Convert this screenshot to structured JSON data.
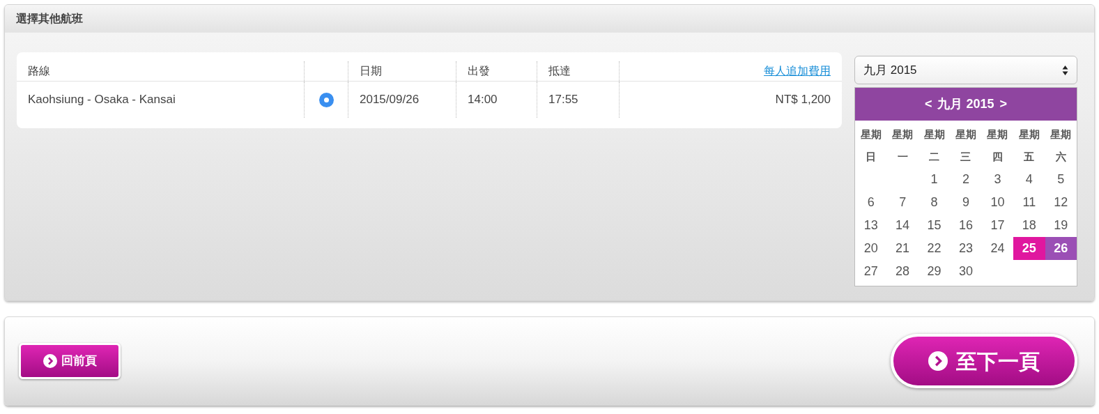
{
  "panel_title": "選擇其他航班",
  "table": {
    "columns": [
      "路線",
      "",
      "日期",
      "出發",
      "抵達",
      "每人追加費用"
    ],
    "rows": [
      {
        "route": "Kaohsiung - Osaka - Kansai",
        "selected": true,
        "date": "2015/09/26",
        "depart": "14:00",
        "arrive": "17:55",
        "fee": "NT$ 1,200"
      }
    ]
  },
  "month_select": {
    "value": "九月 2015"
  },
  "calendar": {
    "prev": "<",
    "title": "九月 2015",
    "next": ">",
    "weekdays": [
      [
        "星期",
        "日"
      ],
      [
        "星期",
        "一"
      ],
      [
        "星期",
        "二"
      ],
      [
        "星期",
        "三"
      ],
      [
        "星期",
        "四"
      ],
      [
        "星期",
        "五"
      ],
      [
        "星期",
        "六"
      ]
    ],
    "weeks": [
      [
        {
          "kind": "blank"
        },
        {
          "kind": "blank"
        },
        {
          "kind": "day",
          "day": "1"
        },
        {
          "kind": "day",
          "day": "2"
        },
        {
          "kind": "day",
          "day": "3"
        },
        {
          "kind": "day",
          "day": "4"
        },
        {
          "kind": "day",
          "day": "5"
        }
      ],
      [
        {
          "kind": "day",
          "day": "6"
        },
        {
          "kind": "day",
          "day": "7"
        },
        {
          "kind": "day",
          "day": "8"
        },
        {
          "kind": "day",
          "day": "9"
        },
        {
          "kind": "day",
          "day": "10"
        },
        {
          "kind": "day",
          "day": "11"
        },
        {
          "kind": "day",
          "day": "12"
        }
      ],
      [
        {
          "kind": "day",
          "day": "13"
        },
        {
          "kind": "day",
          "day": "14"
        },
        {
          "kind": "day",
          "day": "15"
        },
        {
          "kind": "day",
          "day": "16"
        },
        {
          "kind": "day",
          "day": "17"
        },
        {
          "kind": "day",
          "day": "18"
        },
        {
          "kind": "day",
          "day": "19"
        }
      ],
      [
        {
          "kind": "day",
          "day": "20"
        },
        {
          "kind": "day",
          "day": "21"
        },
        {
          "kind": "day",
          "day": "22"
        },
        {
          "kind": "day",
          "day": "23"
        },
        {
          "kind": "day",
          "day": "24"
        },
        {
          "kind": "marked",
          "day": "25",
          "color": "#e0179f"
        },
        {
          "kind": "marked",
          "day": "26",
          "color": "#9b4fb5"
        }
      ],
      [
        {
          "kind": "day",
          "day": "27"
        },
        {
          "kind": "day",
          "day": "28"
        },
        {
          "kind": "day",
          "day": "29"
        },
        {
          "kind": "day",
          "day": "30"
        },
        {
          "kind": "blank"
        },
        {
          "kind": "blank"
        },
        {
          "kind": "blank"
        }
      ]
    ]
  },
  "buttons": {
    "back": "回前頁",
    "next": "至下一頁"
  }
}
